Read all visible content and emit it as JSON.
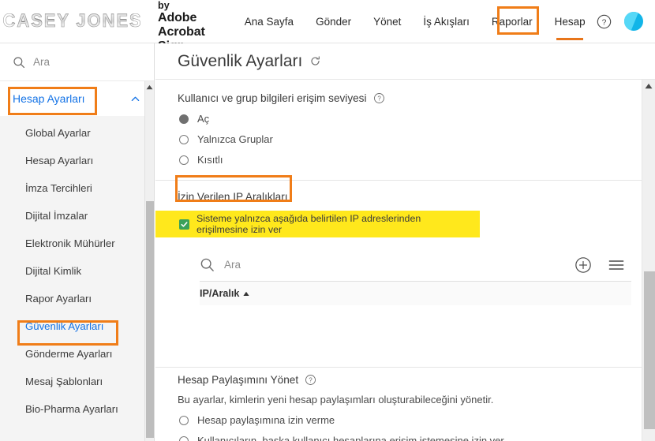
{
  "header": {
    "brand_logo_text": "CASEY JONES",
    "powered_by": "Powered by",
    "product_line1": "Adobe",
    "product_line2": "Acrobat Sign",
    "nav": [
      {
        "label": "Ana Sayfa",
        "active": false
      },
      {
        "label": "Gönder",
        "active": false
      },
      {
        "label": "Yönet",
        "active": false
      },
      {
        "label": "İş Akışları",
        "active": false
      },
      {
        "label": "Raporlar",
        "active": false
      },
      {
        "label": "Hesap",
        "active": true
      }
    ],
    "help_icon": "question-circle-icon",
    "avatar_icon": "user-avatar"
  },
  "sidebar": {
    "search_placeholder": "Ara",
    "search_icon": "search-icon",
    "section_label": "Hesap Ayarları",
    "collapse_icon": "chevron-up-icon",
    "items": [
      {
        "label": "Global Ayarlar",
        "selected": false
      },
      {
        "label": "Hesap Ayarları",
        "selected": false
      },
      {
        "label": "İmza Tercihleri",
        "selected": false
      },
      {
        "label": "Dijital İmzalar",
        "selected": false
      },
      {
        "label": "Elektronik Mühürler",
        "selected": false
      },
      {
        "label": "Dijital Kimlik",
        "selected": false
      },
      {
        "label": "Rapor Ayarları",
        "selected": false
      },
      {
        "label": "Güvenlik Ayarları",
        "selected": true
      },
      {
        "label": "Gönderme Ayarları",
        "selected": false
      },
      {
        "label": "Mesaj Şablonları",
        "selected": false
      },
      {
        "label": "Bio-Pharma Ayarları",
        "selected": false
      }
    ]
  },
  "main": {
    "page_title": "Güvenlik Ayarları",
    "refresh_icon": "refresh-icon",
    "access_section": {
      "heading": "Kullanıcı ve grup bilgileri erişim seviyesi",
      "help_icon": "help-circle-icon",
      "options": [
        {
          "label": "Aç",
          "selected": true
        },
        {
          "label": "Yalnızca Gruplar",
          "selected": false
        },
        {
          "label": "Kısıtlı",
          "selected": false
        }
      ]
    },
    "ip_section": {
      "heading": "İzin Verilen IP Aralıkları",
      "checkbox_label": "Sisteme yalnızca aşağıda belirtilen IP adreslerinden erişilmesine izin ver",
      "checkbox_checked": true,
      "search_placeholder": "Ara",
      "search_icon": "search-icon",
      "add_icon": "plus-circle-icon",
      "menu_icon": "hamburger-menu-icon",
      "table_header": "IP/Aralık",
      "sort_icon": "sort-ascending-icon",
      "rows": []
    },
    "sharing_section": {
      "heading": "Hesap Paylaşımını Yönet",
      "help_icon": "help-circle-icon",
      "description": "Bu ayarlar, kimlerin yeni hesap paylaşımları oluşturabileceğini yönetir.",
      "options": [
        {
          "label": "Hesap paylaşımına izin verme",
          "selected": false
        },
        {
          "label": "Kullanıcıların, başka kullanıcı hesaplarına erişim istemesine izin ver",
          "selected": false
        }
      ]
    }
  },
  "colors": {
    "annotation": "#f07d18",
    "highlight": "#ffe81c",
    "link": "#1473e6",
    "accent": "#e8751a",
    "checkbox": "#3aa15a"
  }
}
